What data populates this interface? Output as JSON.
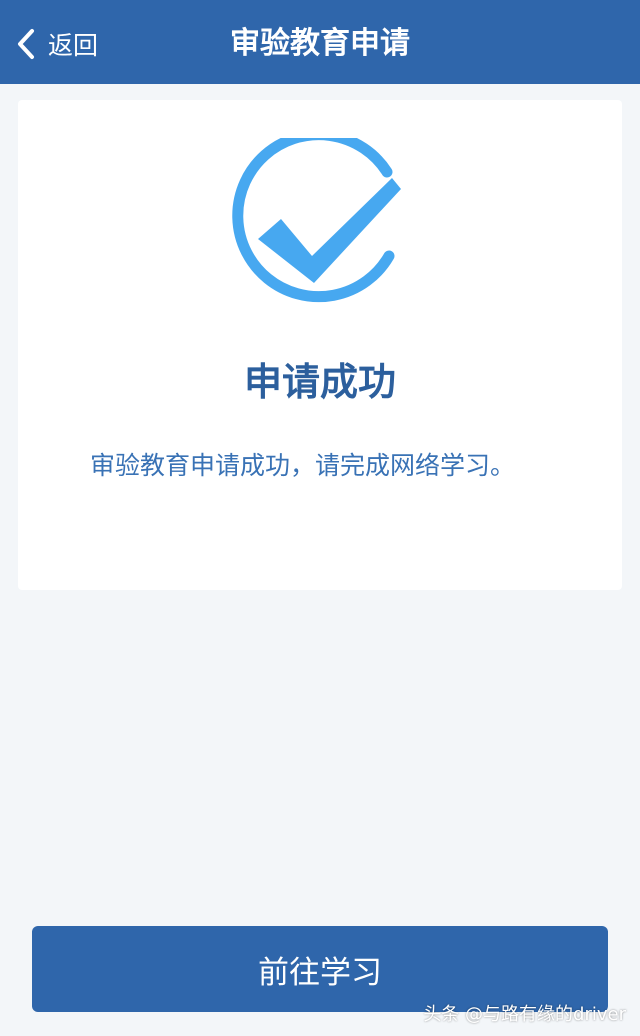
{
  "header": {
    "back_label": "返回",
    "title": "审验教育申请"
  },
  "result": {
    "icon": "check-circle-icon",
    "title": "申请成功",
    "message": "审验教育申请成功，请完成网络学习。"
  },
  "footer": {
    "primary_button_label": "前往学习"
  },
  "watermark": "头条 @与路有缘的driver",
  "colors": {
    "header_bg": "#2f66ab",
    "page_bg": "#f3f6f9",
    "card_bg": "#ffffff",
    "success_icon": "#47a8f0",
    "title_text": "#2c5f9d",
    "message_text": "#3972b5",
    "button_bg": "#2f66ab"
  }
}
